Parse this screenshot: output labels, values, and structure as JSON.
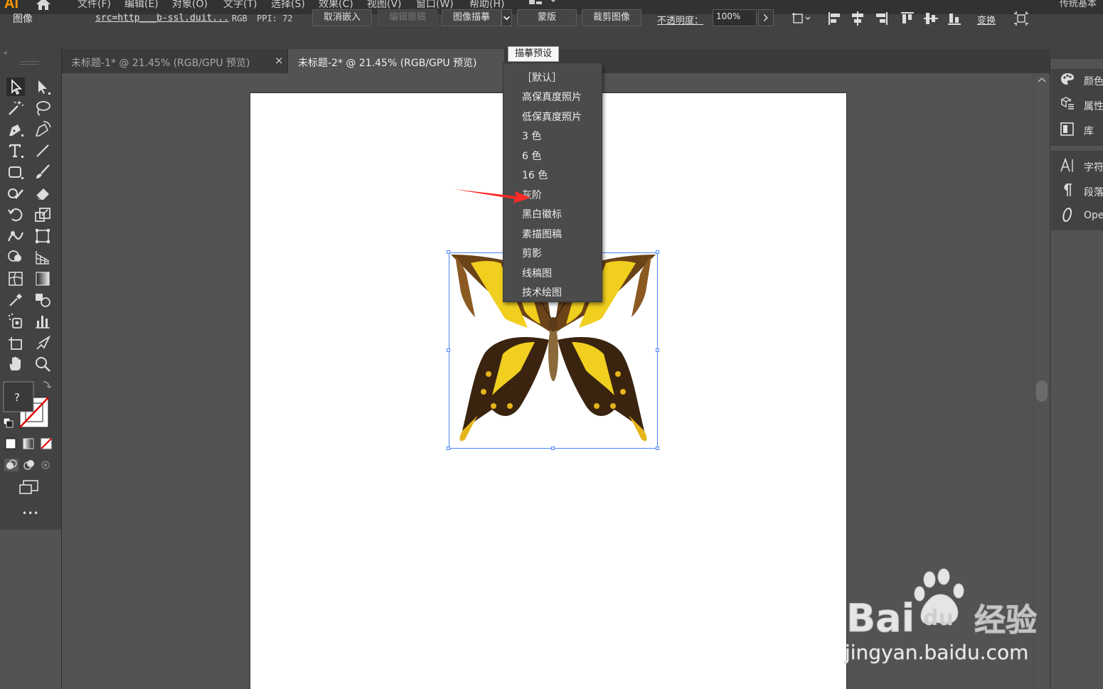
{
  "app": {
    "logo": "Ai",
    "workspace": "传统基本"
  },
  "menu": [
    {
      "label": "文件(F)"
    },
    {
      "label": "编辑(E)"
    },
    {
      "label": "对象(O)"
    },
    {
      "label": "文字(T)"
    },
    {
      "label": "选择(S)"
    },
    {
      "label": "效果(C)"
    },
    {
      "label": "视图(V)"
    },
    {
      "label": "窗口(W)"
    },
    {
      "label": "帮助(H)"
    }
  ],
  "control": {
    "object_type": "图像",
    "filename": "src=http___b-ssl.duit...",
    "color_mode": "RGB",
    "ppi": "PPI: 72",
    "unembed": "取消嵌入",
    "edit_original": "编辑原稿",
    "image_trace": "图像描摹",
    "mask": "蒙版",
    "crop": "裁剪图像",
    "opacity_label": "不透明度：",
    "opacity_value": "100%",
    "transform": "变换"
  },
  "tabs": [
    {
      "title": "未标题-1* @ 21.45% (RGB/GPU 预览)",
      "close": "×"
    },
    {
      "title": "未标题-2* @ 21.45% (RGB/GPU 预览)"
    }
  ],
  "toolbar": {
    "unknown_fill": "?",
    "more": "•••",
    "collapse": "«"
  },
  "trace_presets": {
    "tooltip": "描摹预设",
    "items": [
      {
        "label": "［默认］"
      },
      {
        "label": "高保真度照片"
      },
      {
        "label": "低保真度照片"
      },
      {
        "label": "3 色"
      },
      {
        "label": "6 色"
      },
      {
        "label": "16 色"
      },
      {
        "label": "灰阶"
      },
      {
        "label": "黑白徽标"
      },
      {
        "label": "素描图稿"
      },
      {
        "label": "剪影"
      },
      {
        "label": "线稿图"
      },
      {
        "label": "技术绘图"
      }
    ]
  },
  "panels": [
    {
      "label": "颜色",
      "icon": "palette-icon"
    },
    {
      "label": "属性",
      "icon": "properties-icon"
    },
    {
      "label": "库",
      "icon": "library-icon"
    },
    {
      "label": "字符",
      "icon": "character-icon"
    },
    {
      "label": "段落",
      "icon": "paragraph-icon"
    },
    {
      "label": "OpenType",
      "icon": "opentype-icon"
    }
  ],
  "watermark": {
    "brand": "Bai",
    "brand2": "du",
    "cn": "经验",
    "url": "jingyan.baidu.com"
  },
  "colors": {
    "accent": "#ff9a00",
    "selection": "#4a86ff",
    "arrow": "#ff2a2a"
  }
}
